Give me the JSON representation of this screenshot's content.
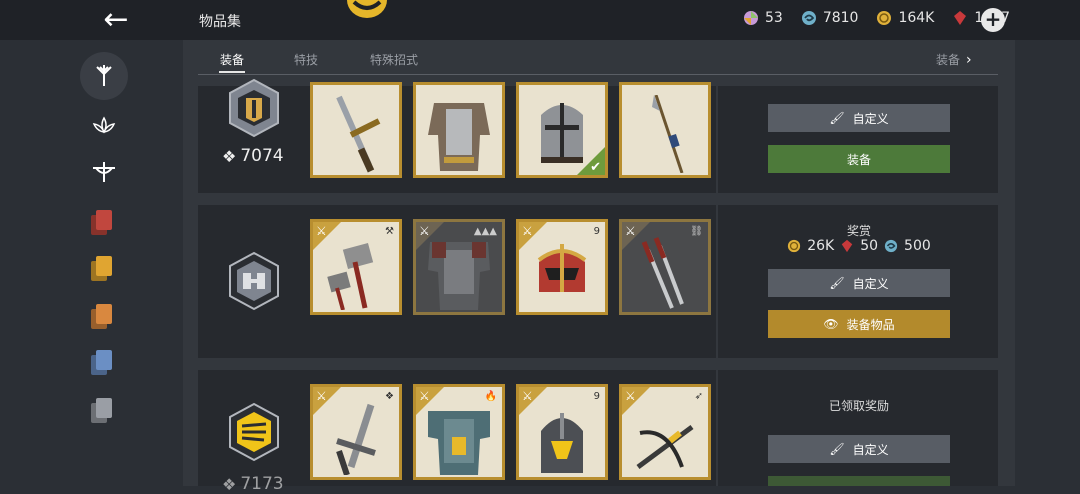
{
  "header": {
    "back_label": "←",
    "title": "物品集",
    "currencies": [
      {
        "name": "pinwheel",
        "value": "53",
        "color": "#c79ad6"
      },
      {
        "name": "swirl",
        "value": "7810",
        "color": "#6fb0c9"
      },
      {
        "name": "coin",
        "value": "164K",
        "color": "#e0b13a"
      },
      {
        "name": "ruby",
        "value": "1547",
        "color": "#c8393b"
      }
    ],
    "add_label": "+"
  },
  "sidebar": {
    "items": [
      {
        "name": "weapon-category",
        "icon": "sword-emblem-icon",
        "active": true
      },
      {
        "name": "lotus-category",
        "icon": "lotus-icon"
      },
      {
        "name": "bow-category",
        "icon": "bow-emblem-icon"
      },
      {
        "name": "red-cards",
        "color": "#c1473e"
      },
      {
        "name": "yellow-cards",
        "color": "#e0a531"
      },
      {
        "name": "orange-cards",
        "color": "#d9883f"
      },
      {
        "name": "blue-cards",
        "color": "#6b8fc4"
      },
      {
        "name": "grey-cards",
        "color": "#9a9ea5"
      }
    ]
  },
  "tabs": [
    {
      "label": "装备",
      "active": true
    },
    {
      "label": "特技"
    },
    {
      "label": "特殊招式"
    }
  ],
  "tabs_right": {
    "label": "装备",
    "chevron": "›"
  },
  "rows": [
    {
      "score": "7074",
      "items": [
        {
          "type": "sword",
          "style": "light"
        },
        {
          "type": "armor",
          "style": "light"
        },
        {
          "type": "helmet",
          "style": "light",
          "checked": true
        },
        {
          "type": "spear",
          "style": "light"
        }
      ],
      "buttons": [
        {
          "label": "自定义",
          "style": "grey",
          "icon": "brush-icon"
        },
        {
          "label": "装备",
          "style": "green"
        }
      ]
    },
    {
      "reward_title": "奖赏",
      "rewards": [
        {
          "icon": "coin",
          "value": "26K"
        },
        {
          "icon": "ruby",
          "value": "50"
        },
        {
          "icon": "swirl",
          "value": "500"
        }
      ],
      "items": [
        {
          "type": "hammer",
          "style": "light",
          "glyph": "⚒"
        },
        {
          "type": "armor",
          "style": "dark",
          "glyph": "▲▲▲"
        },
        {
          "type": "helmet",
          "style": "light",
          "glyph": "9"
        },
        {
          "type": "daggers",
          "style": "dark",
          "glyph": "⛓"
        }
      ],
      "buttons": [
        {
          "label": "自定义",
          "style": "grey",
          "icon": "brush-icon"
        },
        {
          "label": "装备物品",
          "style": "gold",
          "icon": "eye-icon"
        }
      ]
    },
    {
      "claimed": "已领取奖励",
      "score": "7173",
      "items": [
        {
          "type": "sword",
          "style": "light",
          "glyph": "❖"
        },
        {
          "type": "armor",
          "style": "light",
          "glyph": "🔥"
        },
        {
          "type": "helmet",
          "style": "light",
          "glyph": "9"
        },
        {
          "type": "crossbow",
          "style": "light",
          "glyph": "➶"
        }
      ],
      "buttons": [
        {
          "label": "自定义",
          "style": "grey",
          "icon": "brush-icon"
        }
      ]
    }
  ]
}
